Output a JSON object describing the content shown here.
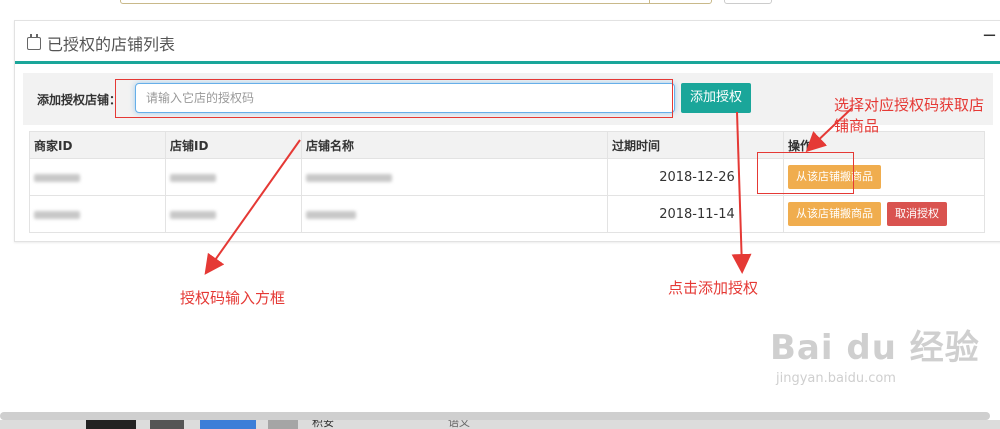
{
  "panel": {
    "title": "已授权的店铺列表",
    "collapse_symbol": "−"
  },
  "add_form": {
    "label": "添加授权店铺：",
    "input_placeholder": "请输入它店的授权码",
    "input_value": "",
    "button_label": "添加授权"
  },
  "table": {
    "headers": [
      "商家ID",
      "店铺ID",
      "店铺名称",
      "过期时间",
      "操作"
    ],
    "rows": [
      {
        "expiry": "2018-12-26",
        "actions": [
          "从该店铺搬商品"
        ]
      },
      {
        "expiry": "2018-11-14",
        "actions": [
          "从该店铺搬商品",
          "取消授权"
        ]
      }
    ]
  },
  "annotations": {
    "input_note": "授权码输入方框",
    "add_note": "点击添加授权",
    "select_note_line1": "选择对应授权码获取店",
    "select_note_line2": "铺商品",
    "color": "#e53935"
  },
  "watermark": {
    "logo": "Bai du 经验",
    "url": "jingyan.baidu.com"
  },
  "taskbar": {
    "item_text": "积安",
    "item_text2": "语义"
  },
  "colors": {
    "accent": "#1aa69a",
    "orange": "#f0ad4e",
    "red": "#d9534f"
  }
}
